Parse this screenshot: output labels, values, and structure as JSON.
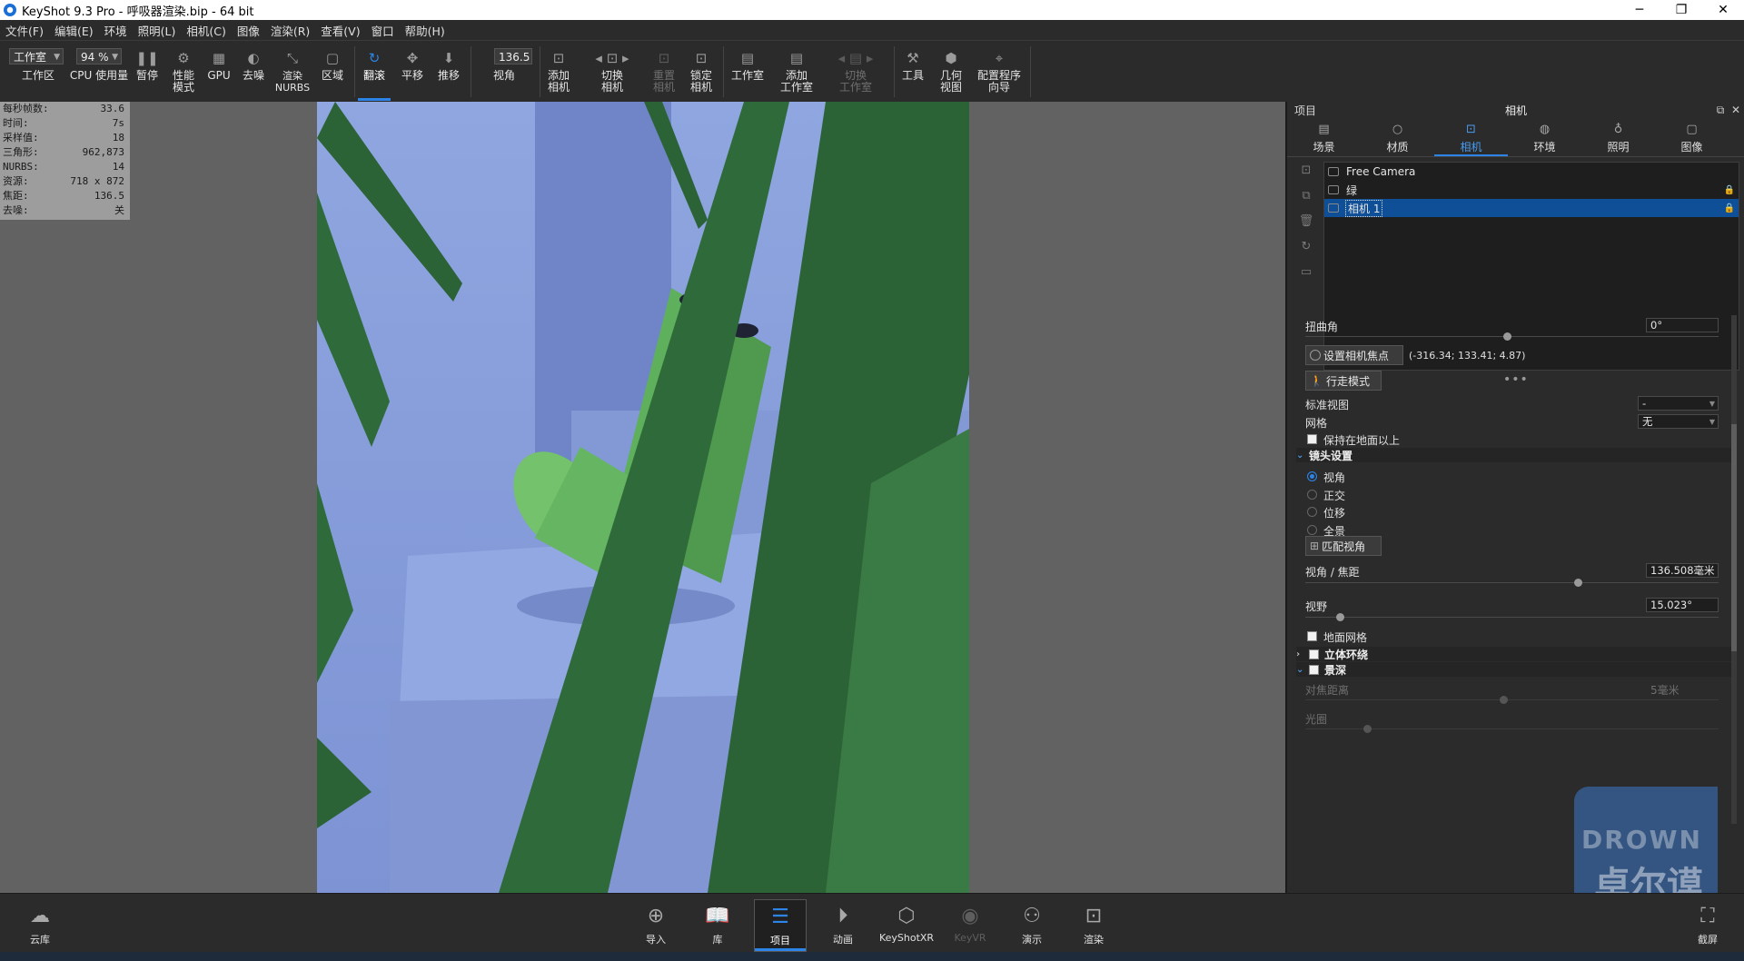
{
  "window": {
    "title": "KeyShot 9.3 Pro  - 呼吸器渲染.bip  - 64 bit",
    "min": "─",
    "max": "❐",
    "close": "✕"
  },
  "menu": [
    "文件(F)",
    "编辑(E)",
    "环境",
    "照明(L)",
    "相机(C)",
    "图像",
    "渲染(R)",
    "查看(V)",
    "窗口",
    "帮助(H)"
  ],
  "toolbar": {
    "workspace_combo": "工作室",
    "cpu_combo": "94 %",
    "fov_value": "136.5",
    "items": {
      "workspace": "工作区",
      "cpu": "CPU 使用量",
      "pause": "暂停",
      "perf": "性能\n模式",
      "gpu": "GPU",
      "denoise": "去噪",
      "nurbs": "渲染\nNURBS",
      "region": "区域",
      "tumble": "翻滚",
      "pan": "平移",
      "dolly": "推移",
      "fov": "视角",
      "add_camera": "添加\n相机",
      "switch_camera": "切换\n相机",
      "reset_camera": "重置\n相机",
      "lock_camera": "锁定\n相机",
      "studio": "工作室",
      "add_studio": "添加\n工作室",
      "switch_studio": "切换\n工作室",
      "tools": "工具",
      "geometry_view": "几何\n视图",
      "wizard": "配置程序\n向导"
    }
  },
  "stats": [
    {
      "k": "每秒帧数:",
      "v": "33.6"
    },
    {
      "k": "时间:",
      "v": "7s"
    },
    {
      "k": "采样值:",
      "v": "18"
    },
    {
      "k": "三角形:",
      "v": "962,873"
    },
    {
      "k": "NURBS:",
      "v": "14"
    },
    {
      "k": "资源:",
      "v": "718 x 872"
    },
    {
      "k": "焦距:",
      "v": "136.5"
    },
    {
      "k": "去噪:",
      "v": "关"
    }
  ],
  "panel": {
    "left_title": "项目",
    "center_title": "相机",
    "tabs": [
      "场景",
      "材质",
      "相机",
      "环境",
      "照明",
      "图像"
    ],
    "cameras": [
      "Free Camera",
      "绿",
      "相机 1"
    ],
    "twist_label": "扭曲角",
    "twist_value": "0°",
    "set_focus_label": "设置相机焦点",
    "focus_coords": "(-316.34; 133.41; 4.87)",
    "walk_mode": "行走模式",
    "std_view_label": "标准视图",
    "std_view_value": "-",
    "grid_label": "网格",
    "grid_value": "无",
    "keep_above": "保持在地面以上",
    "lens_section": "镜头设置",
    "lens_options": [
      "视角",
      "正交",
      "位移",
      "全景"
    ],
    "match_fov": "匹配视角",
    "fov_focal_label": "视角 / 焦距",
    "fov_focal_value": "136.508毫米",
    "fov_label": "视野",
    "fov_value": "15.023°",
    "ground_grid": "地面网格",
    "stereo": "立体环绕",
    "dof": "景深",
    "focus_distance": "对焦距离",
    "focus_distance_value": "5毫米",
    "aperture": "光圈"
  },
  "bottom": {
    "cloud": "云库",
    "items": [
      "导入",
      "库",
      "项目",
      "动画",
      "KeyShotXR",
      "KeyVR",
      "演示",
      "渲染"
    ],
    "screenshot": "截屏"
  },
  "watermark": {
    "line1": "DROWN",
    "line2": "卓尔谟"
  }
}
